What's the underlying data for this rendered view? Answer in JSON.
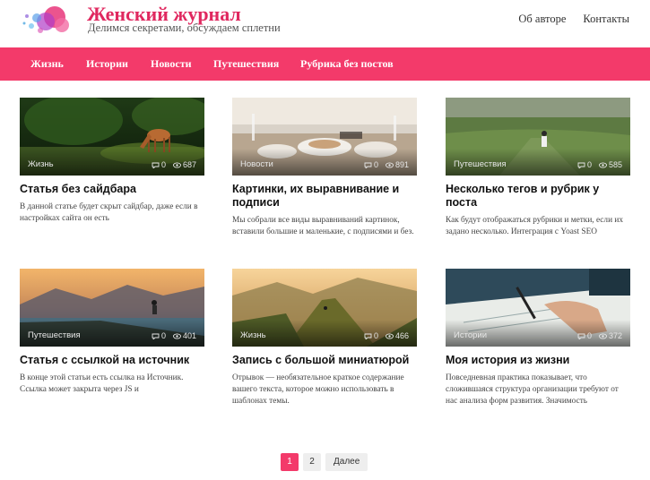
{
  "site": {
    "title": "Женский журнал",
    "description": "Делимся секретами, обсуждаем сплетни"
  },
  "top_links": [
    "Об авторе",
    "Контакты"
  ],
  "nav": [
    "Жизнь",
    "Истории",
    "Новости",
    "Путешествия",
    "Рубрика без постов"
  ],
  "cards": [
    {
      "category": "Жизнь",
      "comments": "0",
      "views": "687",
      "title": "Статья без сайдбара",
      "excerpt": "В данной статье будет скрыт сайдбар, даже если в настройках сайта он есть"
    },
    {
      "category": "Новости",
      "comments": "0",
      "views": "891",
      "title": "Картинки, их выравнивание и подписи",
      "excerpt": "Мы собрали все виды выравниваний картинок, вставили большие и маленькие, с подписями и без."
    },
    {
      "category": "Путешествия",
      "comments": "0",
      "views": "585",
      "title": "Несколько тегов и рубрик у поста",
      "excerpt": "Как будут отображаться рубрики и метки, если их задано несколько. Интеграция с Yoast SEO"
    },
    {
      "category": "Путешествия",
      "comments": "0",
      "views": "401",
      "title": "Статья с ссылкой на источник",
      "excerpt": "В конце этой статьи есть ссылка на Источник. Ссылка может закрыта через JS и"
    },
    {
      "category": "Жизнь",
      "comments": "0",
      "views": "466",
      "title": "Запись с большой миниатюрой",
      "excerpt": "Отрывок — необязательное краткое содержание вашего текста, которое можно использовать в шаблонах темы."
    },
    {
      "category": "Истории",
      "comments": "0",
      "views": "372",
      "title": "Моя история из жизни",
      "excerpt": "Повседневная практика показывает, что сложившаяся структура организации требуют от нас анализа форм развития. Значимость"
    }
  ],
  "pagination": {
    "pages": [
      "1",
      "2"
    ],
    "next": "Далее"
  },
  "colors": {
    "accent": "#f33a6a",
    "title": "#e0285f"
  }
}
